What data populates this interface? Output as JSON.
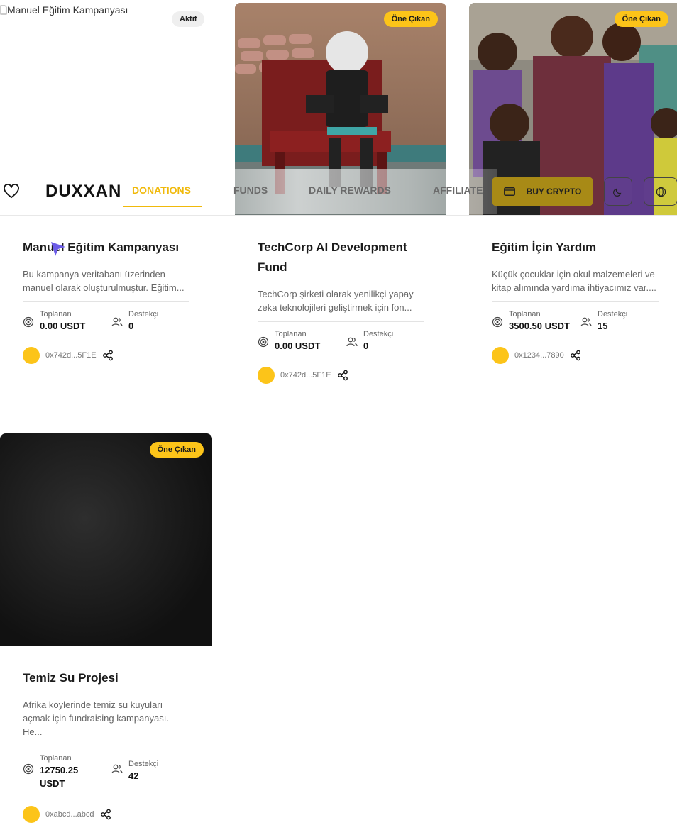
{
  "header": {
    "logo": "DUXXAN",
    "nav": [
      "DONATIONS",
      "FUNDS",
      "DAILY REWARDS",
      "AFFILIATE"
    ],
    "active_nav": "DONATIONS",
    "buy_label": "BUY CRYPTO",
    "icons": [
      "heart-icon",
      "card-icon",
      "moon-icon",
      "globe-icon"
    ],
    "accent": "#f0b90b"
  },
  "labels": {
    "raised": "Toplanan",
    "backers": "Destekçi"
  },
  "campaigns": [
    {
      "title": "Manuel Eğitim Kampanyası",
      "image_alt": "Manuel Eğitim Kampanyası",
      "badge": "Aktif",
      "description": "Bu kampanya veritabanı üzerinden manuel olarak oluşturulmuştur. Eğitim...",
      "raised": "0.00 USDT",
      "backers": "0",
      "owner": "0x742d...5F1E"
    },
    {
      "title": "TechCorp AI Development Fund",
      "badge": "Öne Çıkan",
      "description": "TechCorp şirketi olarak yenilikçi yapay zeka teknolojileri geliştirmek için fon...",
      "raised": "0.00 USDT",
      "backers": "0",
      "owner": "0x742d...5F1E"
    },
    {
      "title": "Eğitim İçin Yardım",
      "badge": "Öne Çıkan",
      "description": "Küçük çocuklar için okul malzemeleri ve kitap alımında yardıma ihtiyacımız var....",
      "raised": "3500.50 USDT",
      "backers": "15",
      "owner": "0x1234...7890"
    },
    {
      "title": "Temiz Su Projesi",
      "badge": "Öne Çıkan",
      "description": "Afrika köylerinde temiz su kuyuları açmak için fundraising kampanyası. He...",
      "raised": "12750.25 USDT",
      "backers": "42",
      "owner": "0xabcd...abcd"
    }
  ]
}
